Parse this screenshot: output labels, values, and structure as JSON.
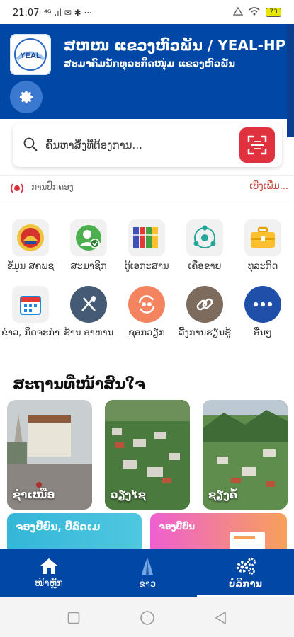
{
  "status_bar": {
    "time": "21:07",
    "left_indicators": "⁴ᴳ .ıl ✉ ✱ ···",
    "battery": "73"
  },
  "header": {
    "title": "ສຫໜ ແຂວງຫົວພັນ / YEAL-HP",
    "subtitle": "ສະມາຄົມນັກທຸລະກິດໜຸ່ມ ແຂວງຫົວພັນ",
    "logo_text": "YEAL",
    "bg_color": "#0047a6"
  },
  "search": {
    "placeholder": "ຄົ້ນຫາສິ່ງທີ່ຕ້ອງການ..."
  },
  "notice": {
    "label": "ການປົກຄອງ",
    "more": "ເບິ່ງເພີ່ມ..."
  },
  "menu": [
    {
      "label": "ຂໍ້ມູນ ສຄພຊ",
      "icon": "emblem-icon"
    },
    {
      "label": "ສະມາຊິກ",
      "icon": "member-icon"
    },
    {
      "label": "ຕູ້ເອກະສານ",
      "icon": "binders-icon"
    },
    {
      "label": "ເຄືອຂາຍ",
      "icon": "network-icon"
    },
    {
      "label": "ທຸລະກິດ",
      "icon": "briefcase-icon"
    },
    {
      "label": "ຂ່າວ, ກິດຈະກຳ",
      "icon": "calendar-icon"
    },
    {
      "label": "ຮ້ານ ອາຫານ",
      "icon": "restaurant-icon"
    },
    {
      "label": "ຊອກວຽກ",
      "icon": "job-icon"
    },
    {
      "label": "ລີ້ງການຮຽນຮູ້",
      "icon": "link-icon"
    },
    {
      "label": "ອື່ນໆ",
      "icon": "more-icon"
    }
  ],
  "section": {
    "title": "ສະຖານທີ່ໜ້າສົນໃຈ",
    "places": [
      {
        "label": "ຊຳເໜືອ"
      },
      {
        "label": "ວຽງໄຊ"
      },
      {
        "label": "ຊຽງຄໍ້"
      }
    ]
  },
  "promos": [
    {
      "text": "ຈອງປີ້ຍົນ, ປີ້ລົດເມ"
    },
    {
      "text": "ຈອງປີ້ຍົນ"
    }
  ],
  "bottom_nav": {
    "items": [
      {
        "label": "ໜ້າຫຼັກ",
        "icon": "home-icon"
      },
      {
        "label": "ຂ່າວ",
        "icon": "news-icon"
      },
      {
        "label": "ບໍລິການ",
        "icon": "services-icon"
      }
    ],
    "active_index": 2
  }
}
